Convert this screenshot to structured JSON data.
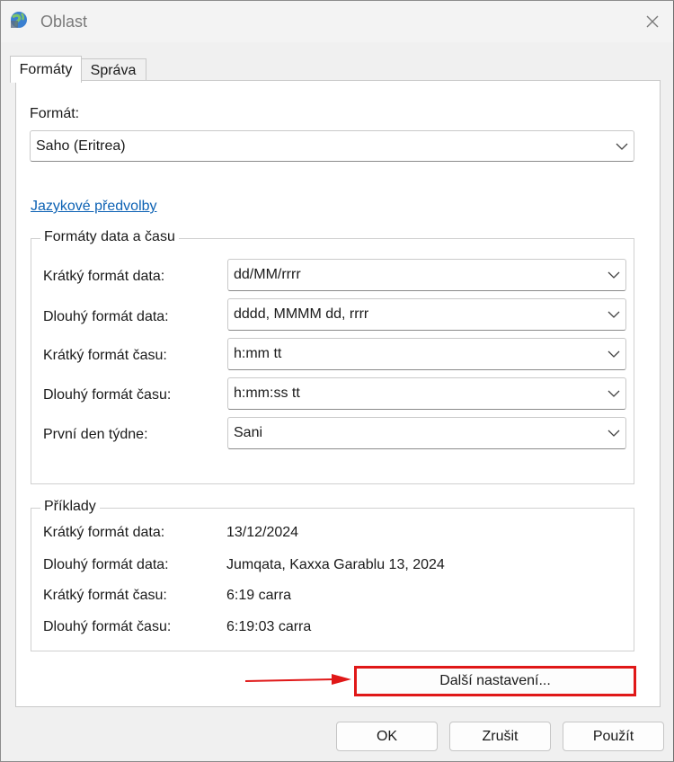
{
  "window": {
    "title": "Oblast"
  },
  "tabs": [
    {
      "label": "Formáty",
      "active": true
    },
    {
      "label": "Správa",
      "active": false
    }
  ],
  "format": {
    "label": "Formát:",
    "value": "Saho (Eritrea)"
  },
  "language_link": "Jazykové předvolby",
  "datetime_group": {
    "title": "Formáty data a času",
    "rows": [
      {
        "label": "Krátký formát data:",
        "value": "dd/MM/rrrr"
      },
      {
        "label": "Dlouhý formát data:",
        "value": "dddd, MMMM dd, rrrr"
      },
      {
        "label": "Krátký formát času:",
        "value": "h:mm tt"
      },
      {
        "label": "Dlouhý formát času:",
        "value": "h:mm:ss tt"
      },
      {
        "label": "První den týdne:",
        "value": "Sani"
      }
    ]
  },
  "examples_group": {
    "title": "Příklady",
    "rows": [
      {
        "label": "Krátký formát data:",
        "value": "13/12/2024"
      },
      {
        "label": "Dlouhý formát data:",
        "value": "Jumqata, Kaxxa Garablu 13, 2024"
      },
      {
        "label": "Krátký formát času:",
        "value": "6:19 carra"
      },
      {
        "label": "Dlouhý formát času:",
        "value": "6:19:03 carra"
      }
    ]
  },
  "more_settings_button": "Další nastavení...",
  "footer": {
    "ok": "OK",
    "cancel": "Zrušit",
    "apply": "Použít"
  },
  "colors": {
    "link": "#0d62b4",
    "highlight": "#e01818"
  },
  "icons": {
    "app": "globe-icon",
    "close": "close-icon",
    "dropdown": "chevron-down-icon",
    "annotation": "red-arrow-icon"
  }
}
